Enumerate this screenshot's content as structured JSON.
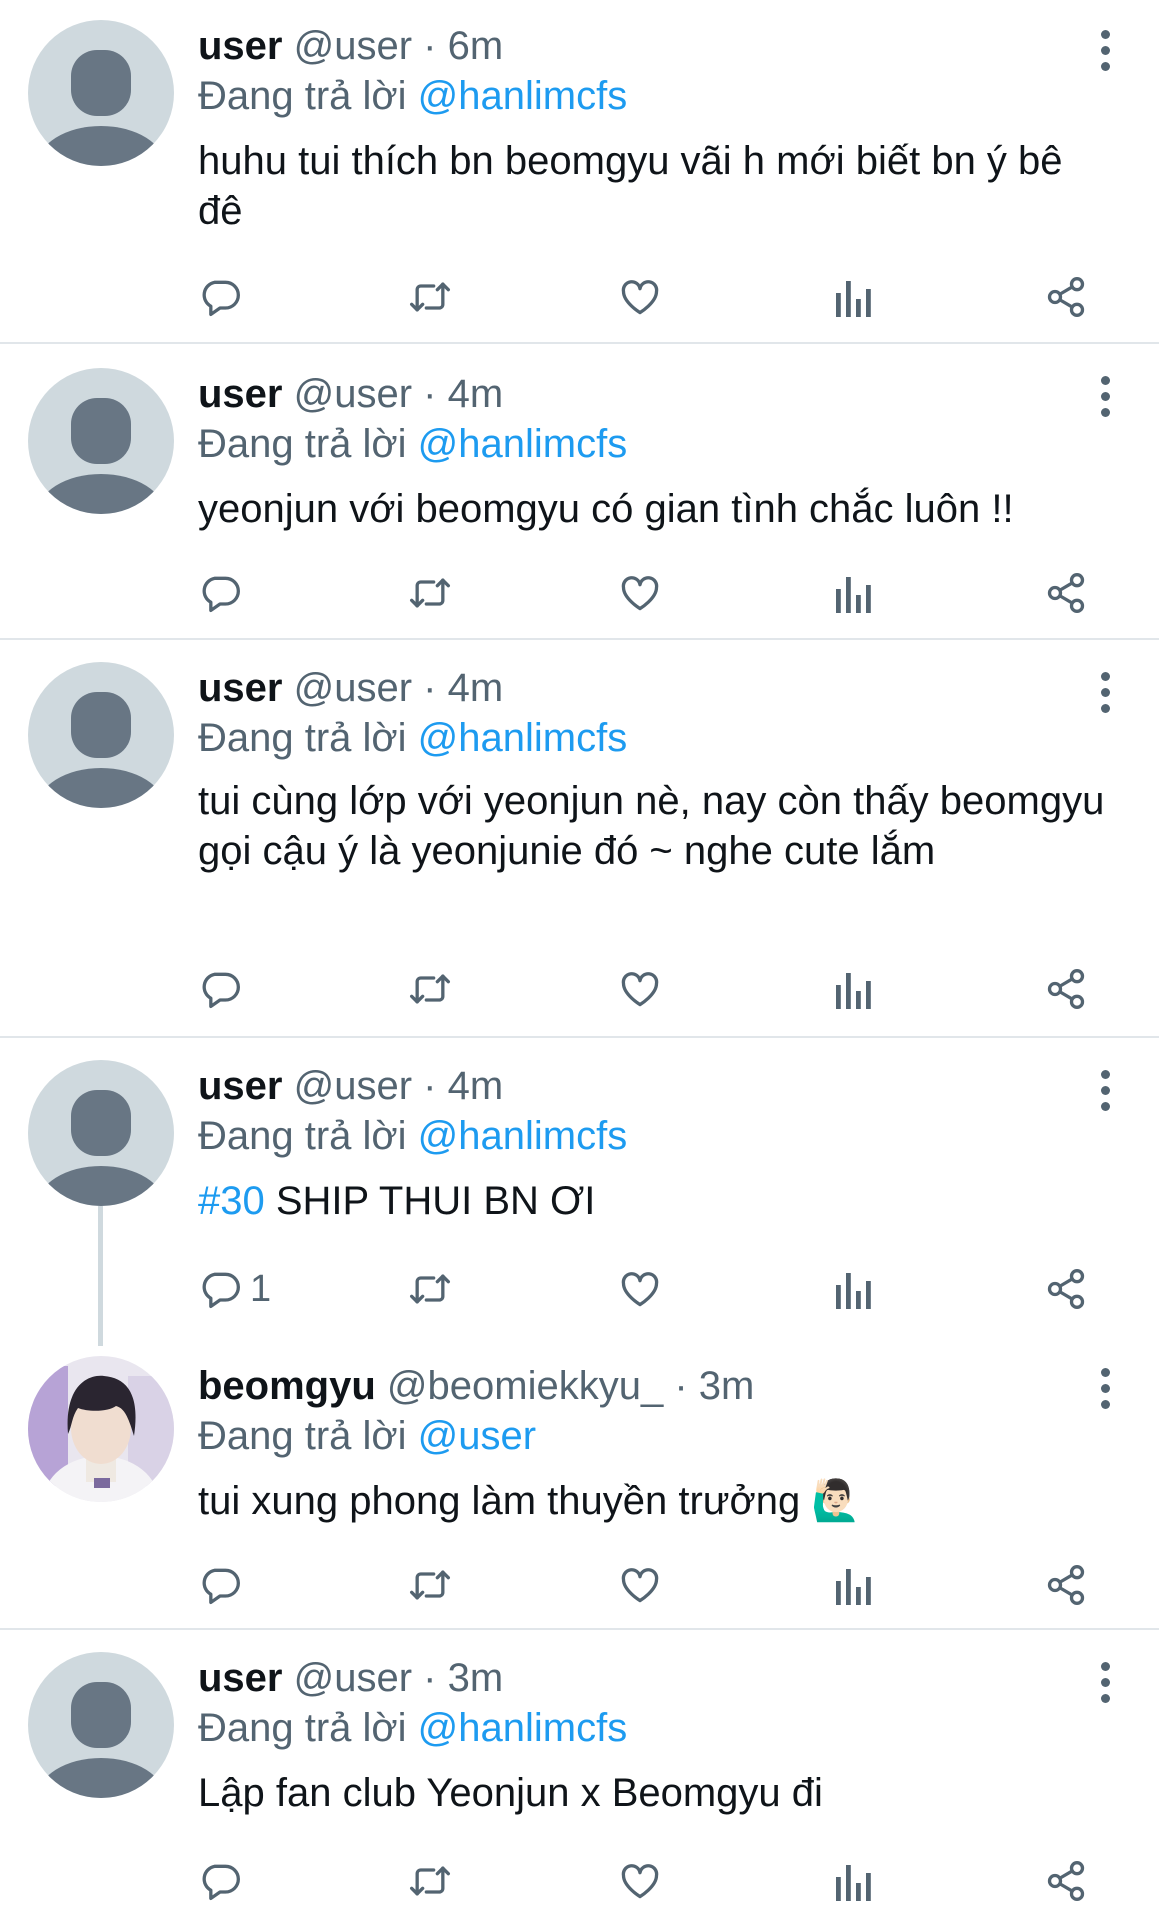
{
  "tweets": [
    {
      "name": "user",
      "handle": "@user",
      "sep": " · ",
      "time": "6m",
      "replying_prefix": "Đang trả lời ",
      "replying_to": "@hanlimcfs",
      "text": "huhu tui thích bn beomgyu vãi h mới biết bn ý bê đê",
      "reply_count": ""
    },
    {
      "name": "user",
      "handle": "@user",
      "sep": " · ",
      "time": "4m",
      "replying_prefix": "Đang trả lời ",
      "replying_to": "@hanlimcfs",
      "text": "yeonjun với beomgyu có gian tình chắc luôn !!",
      "reply_count": ""
    },
    {
      "name": "user",
      "handle": "@user",
      "sep": " · ",
      "time": "4m",
      "replying_prefix": "Đang trả lời ",
      "replying_to": "@hanlimcfs",
      "text": "tui cùng lớp với yeonjun nè, nay còn thấy beomgyu gọi cậu ý là yeonjunie đó ~ nghe cute lắm",
      "reply_count": ""
    },
    {
      "name": "user",
      "handle": "@user",
      "sep": " · ",
      "time": "4m",
      "replying_prefix": "Đang trả lời ",
      "replying_to": "@hanlimcfs",
      "text_hashtag": "#30",
      "text": " SHIP THUI BN ƠI",
      "reply_count": "1"
    },
    {
      "name": "beomgyu",
      "handle": "@beomiekkyu_",
      "sep": " · ",
      "time": "3m",
      "replying_prefix": "Đang trả lời ",
      "replying_to": "@user",
      "text": "tui xung phong làm thuyền trưởng 🙋🏻‍♂️",
      "reply_count": ""
    },
    {
      "name": "user",
      "handle": "@user",
      "sep": " · ",
      "time": "3m",
      "replying_prefix": "Đang trả lời ",
      "replying_to": "@hanlimcfs",
      "text": "Lập fan club Yeonjun x Beomgyu đi",
      "reply_count": ""
    }
  ],
  "icons": {
    "reply": "reply-icon",
    "retweet": "retweet-icon",
    "like": "heart-icon",
    "views": "analytics-icon",
    "share": "share-icon",
    "more": "more-options-icon"
  },
  "colors": {
    "link": "#1d9bf0",
    "secondary": "#536471",
    "divider": "#e1e6ea",
    "default_avatar_bg": "#cfd9de",
    "default_avatar_fg": "#687684"
  }
}
